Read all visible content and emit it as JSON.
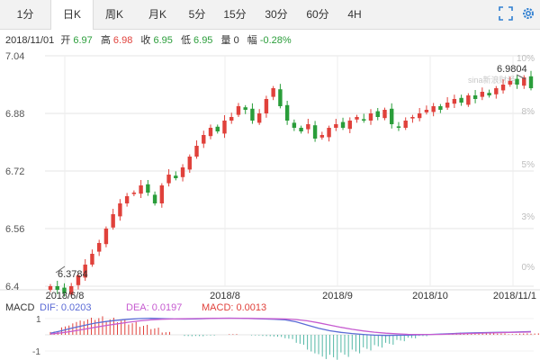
{
  "tabs": [
    {
      "label": "1分"
    },
    {
      "label": "日K"
    },
    {
      "label": "周K"
    },
    {
      "label": "月K"
    },
    {
      "label": "5分"
    },
    {
      "label": "15分"
    },
    {
      "label": "30分"
    },
    {
      "label": "60分"
    },
    {
      "label": "4H"
    }
  ],
  "active_tab": "日K",
  "tools": [
    {
      "icon": "fullscreen-icon"
    },
    {
      "icon": "gear-icon"
    }
  ],
  "info_bar": {
    "date": "2018/11/01",
    "open_label": "开",
    "open": "6.97",
    "high_label": "高",
    "high": "6.98",
    "close_label": "收",
    "close": "6.95",
    "low_label": "低",
    "low": "6.95",
    "volume_label": "量",
    "volume": "0",
    "change_label": "幅",
    "change": "-0.28%"
  },
  "colors": {
    "up": "#e0413b",
    "down": "#2a9d3a",
    "dif": "#5b6bd6",
    "dea": "#c65bd0",
    "grid": "#e5e5e5",
    "axis_text": "#555555"
  },
  "watermark": "sina新浪财经",
  "chart_data": {
    "type": "candlestick",
    "title": "",
    "ylim": [
      6.3784,
      6.9804
    ],
    "y_ticks": [
      "7.04",
      "6.88",
      "6.72",
      "6.56",
      "6.4"
    ],
    "y_tick_values": [
      7.04,
      6.88,
      6.72,
      6.56,
      6.4
    ],
    "pct_ticks": [
      "10%",
      "8%",
      "5%",
      "3%",
      "0%"
    ],
    "pct_tick_values": [
      10,
      8,
      5,
      3,
      0
    ],
    "x_ticks": [
      "2018/6/8",
      "2018/8",
      "2018/9",
      "2018/10",
      "2018/11/1"
    ],
    "annotations": [
      {
        "text": "6.3784",
        "price": 6.3784
      },
      {
        "text": "6.9804",
        "price": 6.9804
      }
    ],
    "close_path": [
      6.4,
      6.39,
      6.38,
      6.4,
      6.43,
      6.46,
      6.49,
      6.52,
      6.56,
      6.6,
      6.63,
      6.65,
      6.66,
      6.68,
      6.66,
      6.63,
      6.68,
      6.71,
      6.7,
      6.73,
      6.76,
      6.79,
      6.82,
      6.84,
      6.83,
      6.86,
      6.87,
      6.9,
      6.89,
      6.86,
      6.88,
      6.92,
      6.95,
      6.9,
      6.86,
      6.84,
      6.83,
      6.85,
      6.81,
      6.82,
      6.84,
      6.85,
      6.84,
      6.86,
      6.87,
      6.86,
      6.88,
      6.87,
      6.89,
      6.85,
      6.84,
      6.86,
      6.87,
      6.88,
      6.89,
      6.9,
      6.89,
      6.91,
      6.92,
      6.91,
      6.93,
      6.92,
      6.94,
      6.93,
      6.95,
      6.96,
      6.97,
      6.96,
      6.98,
      6.95
    ]
  },
  "macd": {
    "label": "MACD",
    "dif_label": "DIF: 0.0203",
    "dea_label": "DEA: 0.0197",
    "macd_label": "MACD: 0.0013",
    "y_ticks": [
      "1",
      "-1"
    ],
    "dif_path": [
      0.1,
      0.25,
      0.42,
      0.58,
      0.72,
      0.82,
      0.9,
      0.96,
      1.0,
      1.02,
      1.0,
      0.98,
      0.97,
      0.98,
      1.0,
      1.02,
      1.03,
      1.02,
      1.0,
      0.98,
      0.96,
      0.92,
      0.8,
      0.6,
      0.4,
      0.25,
      0.15,
      0.08,
      0.02,
      -0.02,
      -0.04,
      -0.03,
      -0.02,
      0.0,
      0.02,
      0.05,
      0.08,
      0.1,
      0.12,
      0.14,
      0.15,
      0.16,
      0.18,
      0.2
    ],
    "dea_path": [
      0.05,
      0.12,
      0.22,
      0.34,
      0.46,
      0.58,
      0.68,
      0.78,
      0.86,
      0.92,
      0.96,
      0.98,
      0.99,
      1.0,
      1.01,
      1.02,
      1.02,
      1.02,
      1.01,
      1.0,
      0.99,
      0.98,
      0.94,
      0.86,
      0.74,
      0.6,
      0.46,
      0.34,
      0.24,
      0.16,
      0.1,
      0.06,
      0.03,
      0.02,
      0.02,
      0.03,
      0.05,
      0.07,
      0.09,
      0.11,
      0.13,
      0.15,
      0.16,
      0.18
    ]
  }
}
